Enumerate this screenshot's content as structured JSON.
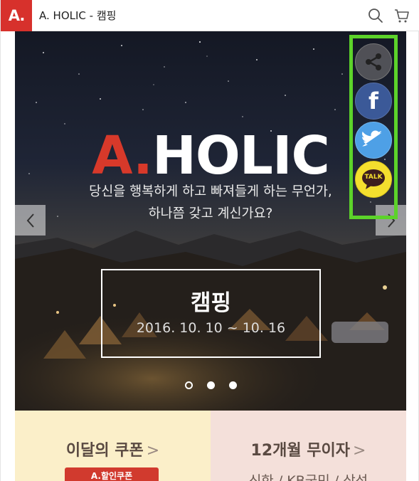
{
  "header": {
    "logo": "A.",
    "title": "A. HOLIC - 캠핑",
    "icons": [
      "search-icon",
      "cart-icon"
    ]
  },
  "banner": {
    "brand_a": "A.",
    "brand_rest": "HOLIC",
    "tagline_line1": "당신을 행복하게 하고 빠져들게 하는 무언가,",
    "tagline_line2": "하나쯤 갖고 계신가요?",
    "event_title": "캠핑",
    "event_dates": "2016. 10. 10 ~ 10. 16",
    "slide_count": 3,
    "active_slide": 1
  },
  "share": {
    "items": [
      "share-icon",
      "facebook-icon",
      "twitter-icon",
      "kakaotalk-icon"
    ],
    "kakao_label": "TALK",
    "facebook_label": "f",
    "highlight_color": "#5cd32a"
  },
  "promo": {
    "left_title": "이달의 쿠폰",
    "left_chevron": ">",
    "left_badge": "A.할인쿠폰",
    "right_title": "12개월 무이자",
    "right_chevron": ">",
    "right_sub": "신한 / KB국민 / 삼성"
  },
  "colors": {
    "brand_red": "#d7312c",
    "promo_left_bg": "#fbefc9",
    "promo_right_bg": "#f4e0da"
  }
}
